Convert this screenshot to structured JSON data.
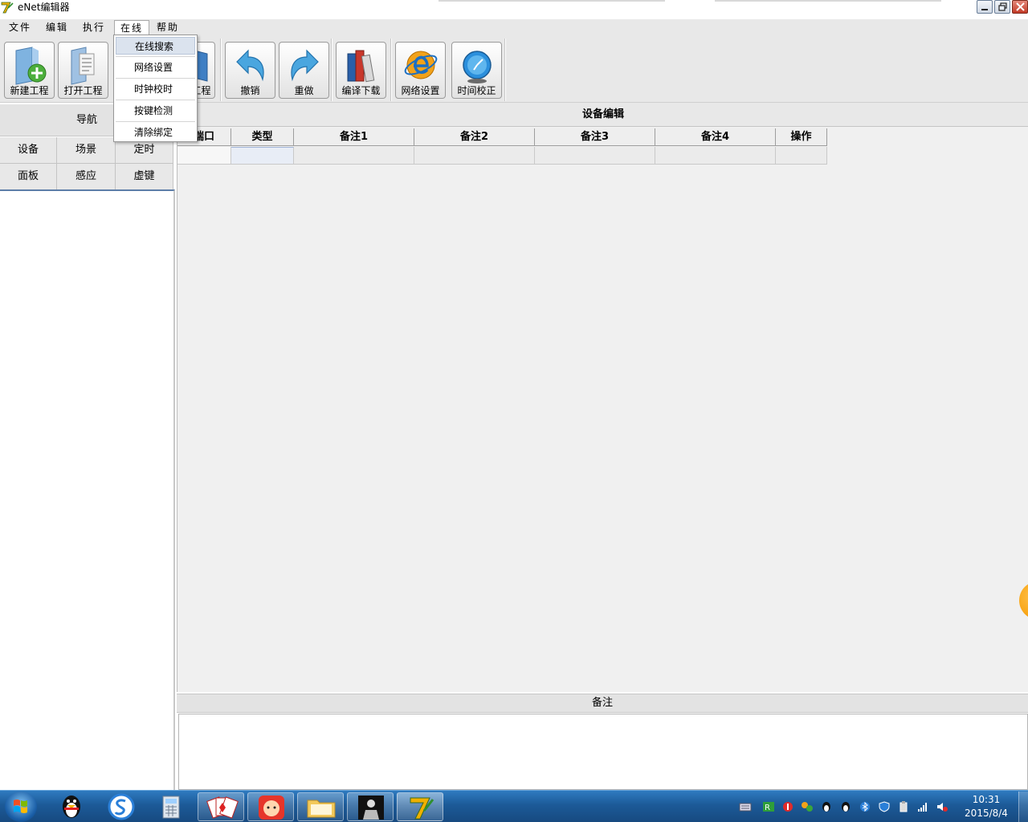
{
  "window": {
    "title": "eNet编辑器"
  },
  "menubar": {
    "items": [
      {
        "label": "文件"
      },
      {
        "label": "编辑"
      },
      {
        "label": "执行"
      },
      {
        "label": "在线"
      },
      {
        "label": "帮助"
      }
    ]
  },
  "online_menu": {
    "items": [
      {
        "label": "在线搜索"
      },
      {
        "label": "网络设置"
      },
      {
        "label": "时钟校时"
      },
      {
        "label": "按键检测"
      },
      {
        "label": "清除绑定"
      }
    ]
  },
  "toolbar": {
    "new_project": "新建工程",
    "open_project": "打开工程",
    "save_project_partial": "工程",
    "undo": "撤销",
    "redo": "重做",
    "compile_download": "编译下载",
    "network_settings": "网络设置",
    "time_calibration": "时间校正"
  },
  "nav": {
    "title": "导航",
    "buttons": [
      {
        "label": "设备"
      },
      {
        "label": "场景"
      },
      {
        "label": "定时"
      },
      {
        "label": "面板"
      },
      {
        "label": "感应"
      },
      {
        "label": "虚键"
      }
    ]
  },
  "device_edit": {
    "title": "设备编辑",
    "columns": [
      "端口",
      "类型",
      "备注1",
      "备注2",
      "备注3",
      "备注4",
      "操作"
    ]
  },
  "remarks": {
    "title": "备注"
  },
  "taskbar": {
    "clock_time": "10:31",
    "clock_date": "2015/8/4"
  },
  "colors": {
    "taskbar": "#1c5a98",
    "panel": "#f0f0f0",
    "menu_highlight": "#dbe3ee",
    "close_button": "#c23a26",
    "edge_widget": "#f59a00"
  }
}
